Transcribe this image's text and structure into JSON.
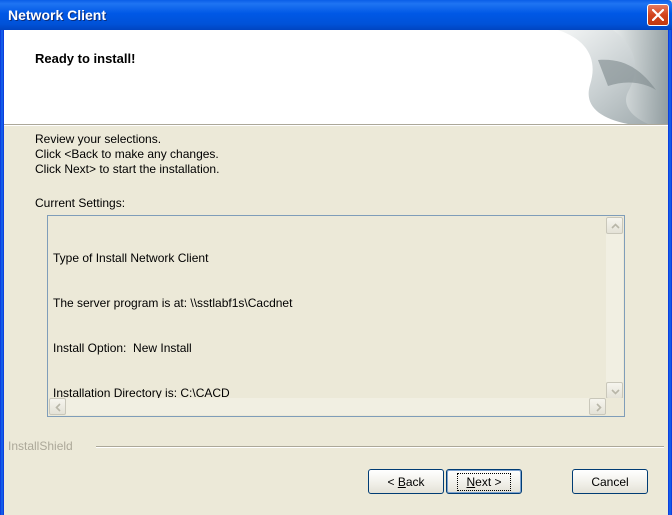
{
  "window": {
    "title": "Network Client"
  },
  "header": {
    "heading": "Ready to install!"
  },
  "instructions": {
    "line1": "Review your selections.",
    "line2": "Click <Back to make any changes.",
    "line3": "Click Next> to start the installation."
  },
  "settings": {
    "label": "Current Settings:",
    "lines": [
      "Type of Install Network Client",
      "The server program is at: \\\\sstlabf1s\\Cacdnet",
      "Install Option:  New Install",
      "Installation Directory is: C:\\CACD"
    ]
  },
  "footer": {
    "brand": "InstallShield"
  },
  "buttons": {
    "back_prefix": "< ",
    "back_mnemonic": "B",
    "back_rest": "ack",
    "next_mnemonic": "N",
    "next_rest": "ext >",
    "cancel": "Cancel"
  },
  "icons": {
    "close": "close-icon",
    "scroll_up": "scroll-up-arrow-icon",
    "scroll_down": "scroll-down-arrow-icon",
    "scroll_left": "scroll-left-arrow-icon",
    "scroll_right": "scroll-right-arrow-icon",
    "banner": "installer-banner-graphic"
  }
}
